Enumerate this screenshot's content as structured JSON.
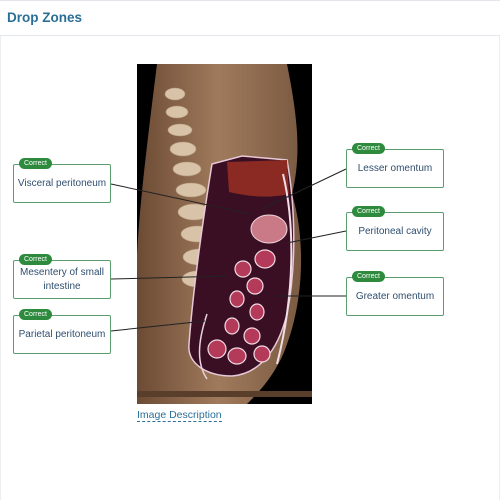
{
  "header": {
    "title": "Drop Zones"
  },
  "image_description_link": "Image Description",
  "zones": [
    {
      "id": "z1",
      "badge": "Correct",
      "label": "Visceral peritoneum"
    },
    {
      "id": "z2",
      "badge": "Correct",
      "label": "Mesentery of small intestine"
    },
    {
      "id": "z3",
      "badge": "Correct",
      "label": "Parietal peritoneum"
    },
    {
      "id": "z4",
      "badge": "Correct",
      "label": "Lesser omentum"
    },
    {
      "id": "z5",
      "badge": "Correct",
      "label": "Peritoneal cavity"
    },
    {
      "id": "z6",
      "badge": "Correct",
      "label": "Greater omentum"
    }
  ],
  "colors": {
    "accent": "#2a6f97",
    "correct_badge": "#2e8b3e",
    "zone_border": "#5a9e6f"
  }
}
